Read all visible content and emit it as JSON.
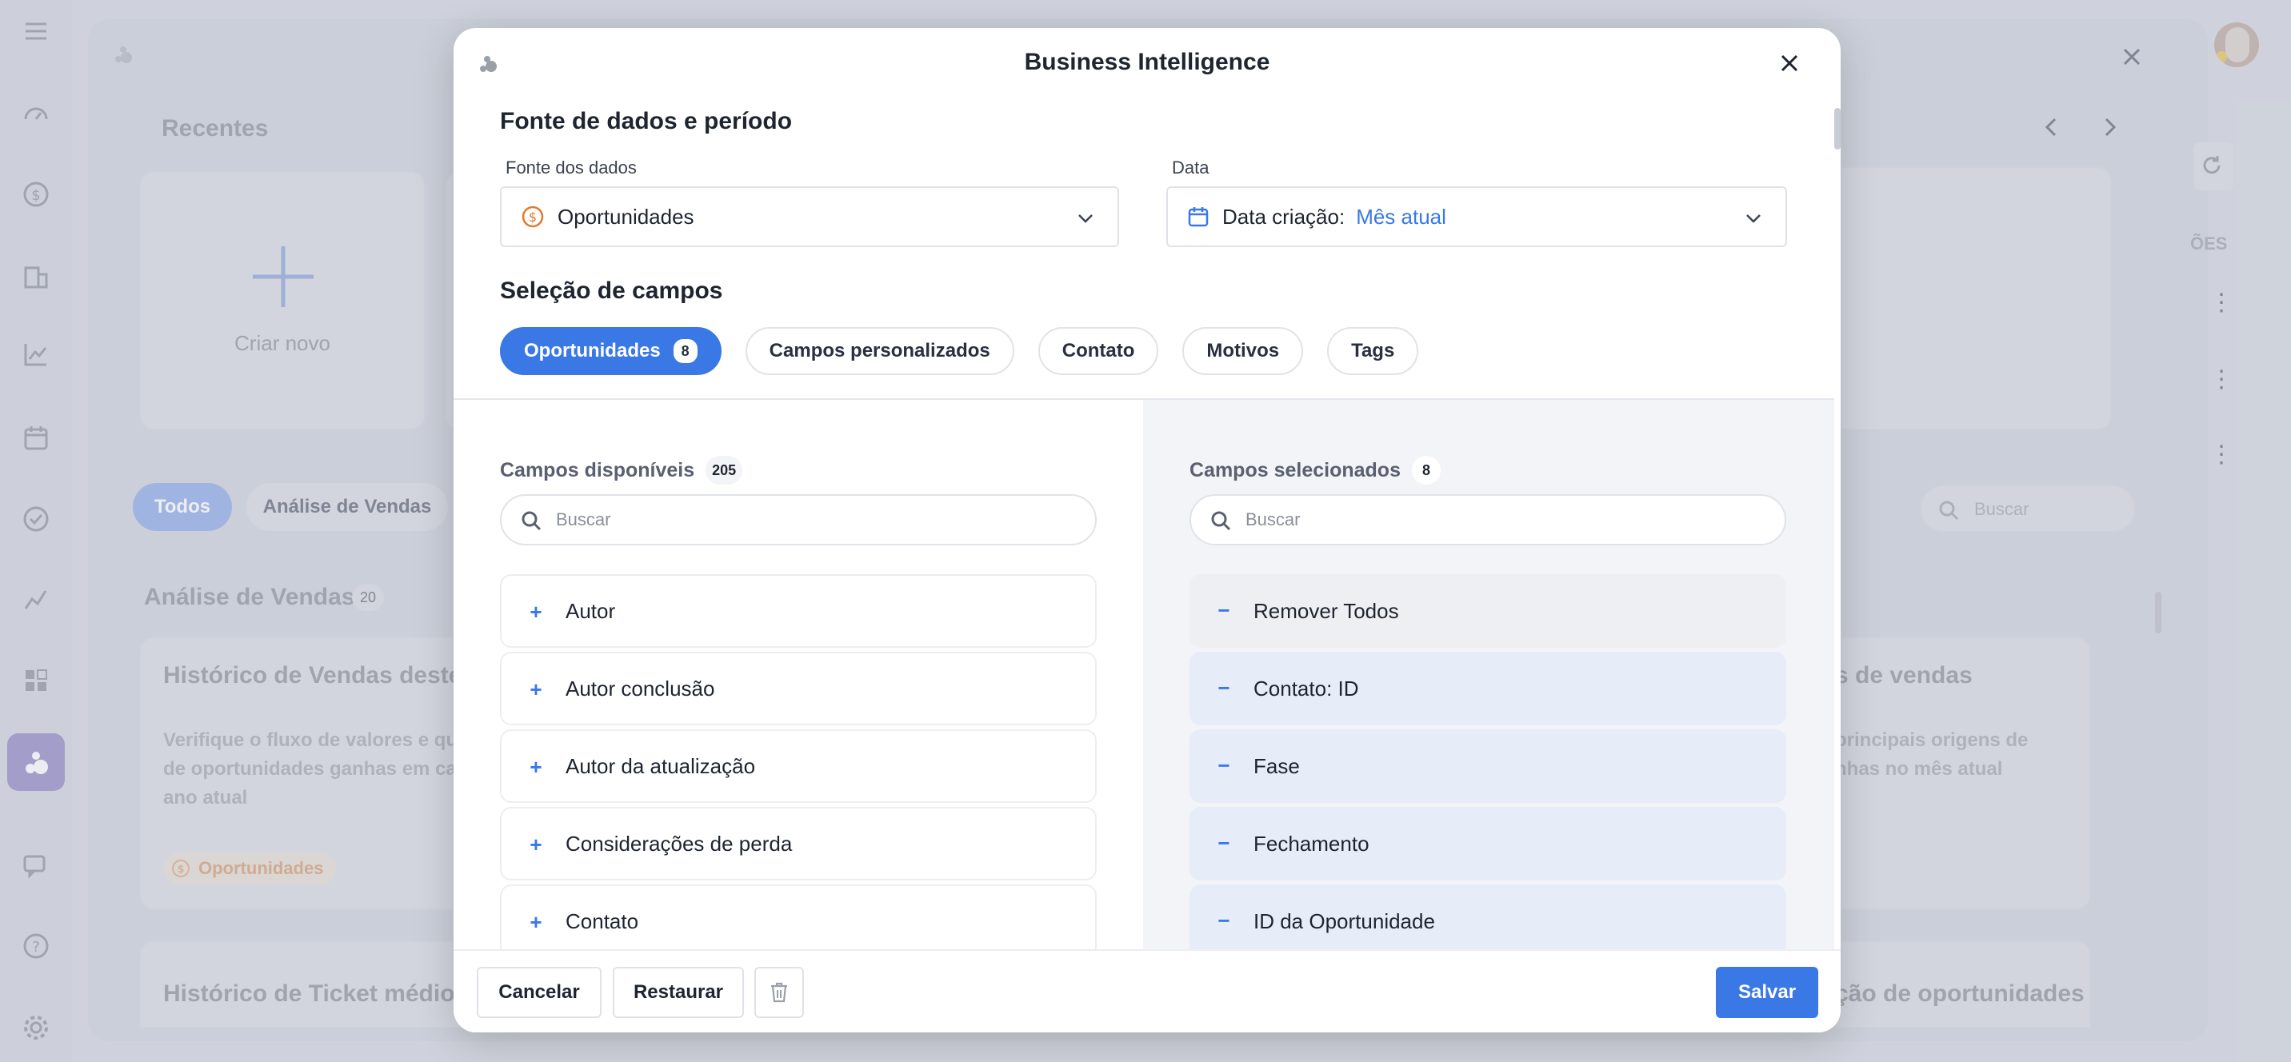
{
  "background": {
    "recentes_title": "Recentes",
    "criar_novo": "Criar novo",
    "filters": [
      "Todos",
      "Análise de Vendas"
    ],
    "section_title": "Análise de Vendas",
    "section_count": "20",
    "card1_title": "Histórico de Vendas deste a",
    "card1_desc_l1": "Verifique o fluxo de valores e qu",
    "card1_desc_l2": "de oportunidades ganhas em ca",
    "card1_desc_l3": "ano atual",
    "card1_badge": "Oportunidades",
    "card2_title": "s de vendas",
    "card2_desc_l1": "principais origens de",
    "card2_desc_l2": "nhas no mês atual",
    "card3_title": "Histórico de Ticket médio de",
    "card4_title": "ção de oportunidades",
    "search_placeholder": "Buscar",
    "col_header": "ÕES"
  },
  "modal": {
    "title": "Business Intelligence",
    "section1": "Fonte de dados e período",
    "fonte_label": "Fonte dos dados",
    "fonte_value": "Oportunidades",
    "data_label": "Data",
    "data_prefix": "Data criação:",
    "data_value": "Mês atual",
    "section2": "Seleção de campos",
    "tabs": [
      {
        "label": "Oportunidades",
        "count": "8"
      },
      {
        "label": "Campos personalizados"
      },
      {
        "label": "Contato"
      },
      {
        "label": "Motivos"
      },
      {
        "label": "Tags"
      }
    ],
    "available": {
      "title": "Campos disponíveis",
      "count": "205",
      "search_placeholder": "Buscar",
      "items": [
        "Autor",
        "Autor conclusão",
        "Autor da atualização",
        "Considerações de perda",
        "Contato"
      ]
    },
    "selected": {
      "title": "Campos selecionados",
      "count": "8",
      "search_placeholder": "Buscar",
      "remove_all": "Remover Todos",
      "items": [
        "Contato: ID",
        "Fase",
        "Fechamento",
        "ID da Oportunidade"
      ]
    },
    "footer": {
      "cancel": "Cancelar",
      "restore": "Restaurar",
      "save": "Salvar"
    }
  },
  "colors": {
    "accent": "#3a78e6",
    "orange": "#e07a2e"
  }
}
